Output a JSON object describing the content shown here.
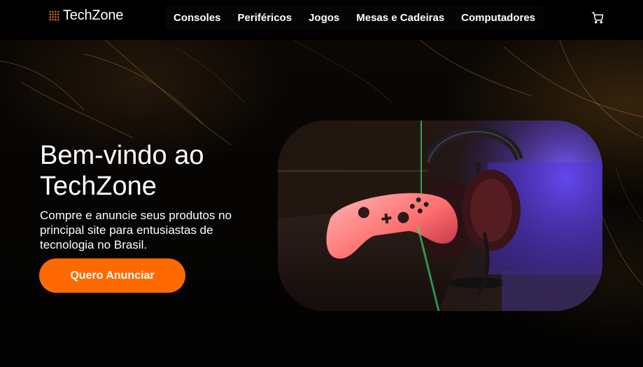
{
  "header": {
    "logo_text": "TechZone",
    "nav": [
      {
        "label": "Consoles"
      },
      {
        "label": "Periféricos"
      },
      {
        "label": "Jogos"
      },
      {
        "label": "Mesas e Cadeiras"
      },
      {
        "label": "Computadores"
      }
    ],
    "cart_icon": "cart-icon"
  },
  "hero": {
    "title": "Bem-vindo ao TechZone",
    "subtitle": "Compre e anuncie seus produtos no principal site para entusiastas de tecnologia no Brasil.",
    "cta_label": "Quero Anunciar",
    "image_subject": "game controller and headset on a chair"
  },
  "colors": {
    "accent": "#ff6a00",
    "background": "#000000",
    "text": "#ffffff"
  }
}
